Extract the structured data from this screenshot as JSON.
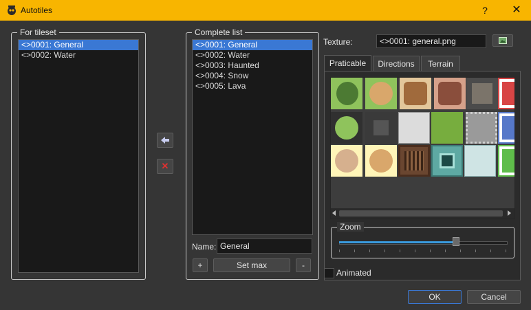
{
  "window": {
    "title": "Autotiles",
    "help": "?",
    "close": "✕"
  },
  "left_group": {
    "title": "For tileset",
    "items": [
      "<>0001: General",
      "<>0002: Water"
    ],
    "selected": 0
  },
  "middle_buttons": {
    "add_icon": "arrow-left-icon",
    "remove_icon": "red-x-icon"
  },
  "complete_group": {
    "title": "Complete list",
    "items": [
      "<>0001: General",
      "<>0002: Water",
      "<>0003: Haunted",
      "<>0004: Snow",
      "<>0005: Lava"
    ],
    "selected": 0,
    "name_label": "Name:",
    "name_value": "General",
    "plus_label": "+",
    "setmax_label": "Set max",
    "minus_label": "-"
  },
  "texture": {
    "label": "Texture:",
    "value": "<>0001: general.png",
    "icon": "image-icon"
  },
  "tabs": [
    "Praticable",
    "Directions",
    "Terrain"
  ],
  "active_tab": 0,
  "zoom": {
    "title": "Zoom",
    "level": 0.71
  },
  "animated": {
    "label": "Animated",
    "checked": false
  },
  "footer": {
    "ok": "OK",
    "cancel": "Cancel"
  },
  "colors": {
    "titlebar": "#f8b500",
    "selection": "#3a78d4",
    "background": "#353535"
  }
}
